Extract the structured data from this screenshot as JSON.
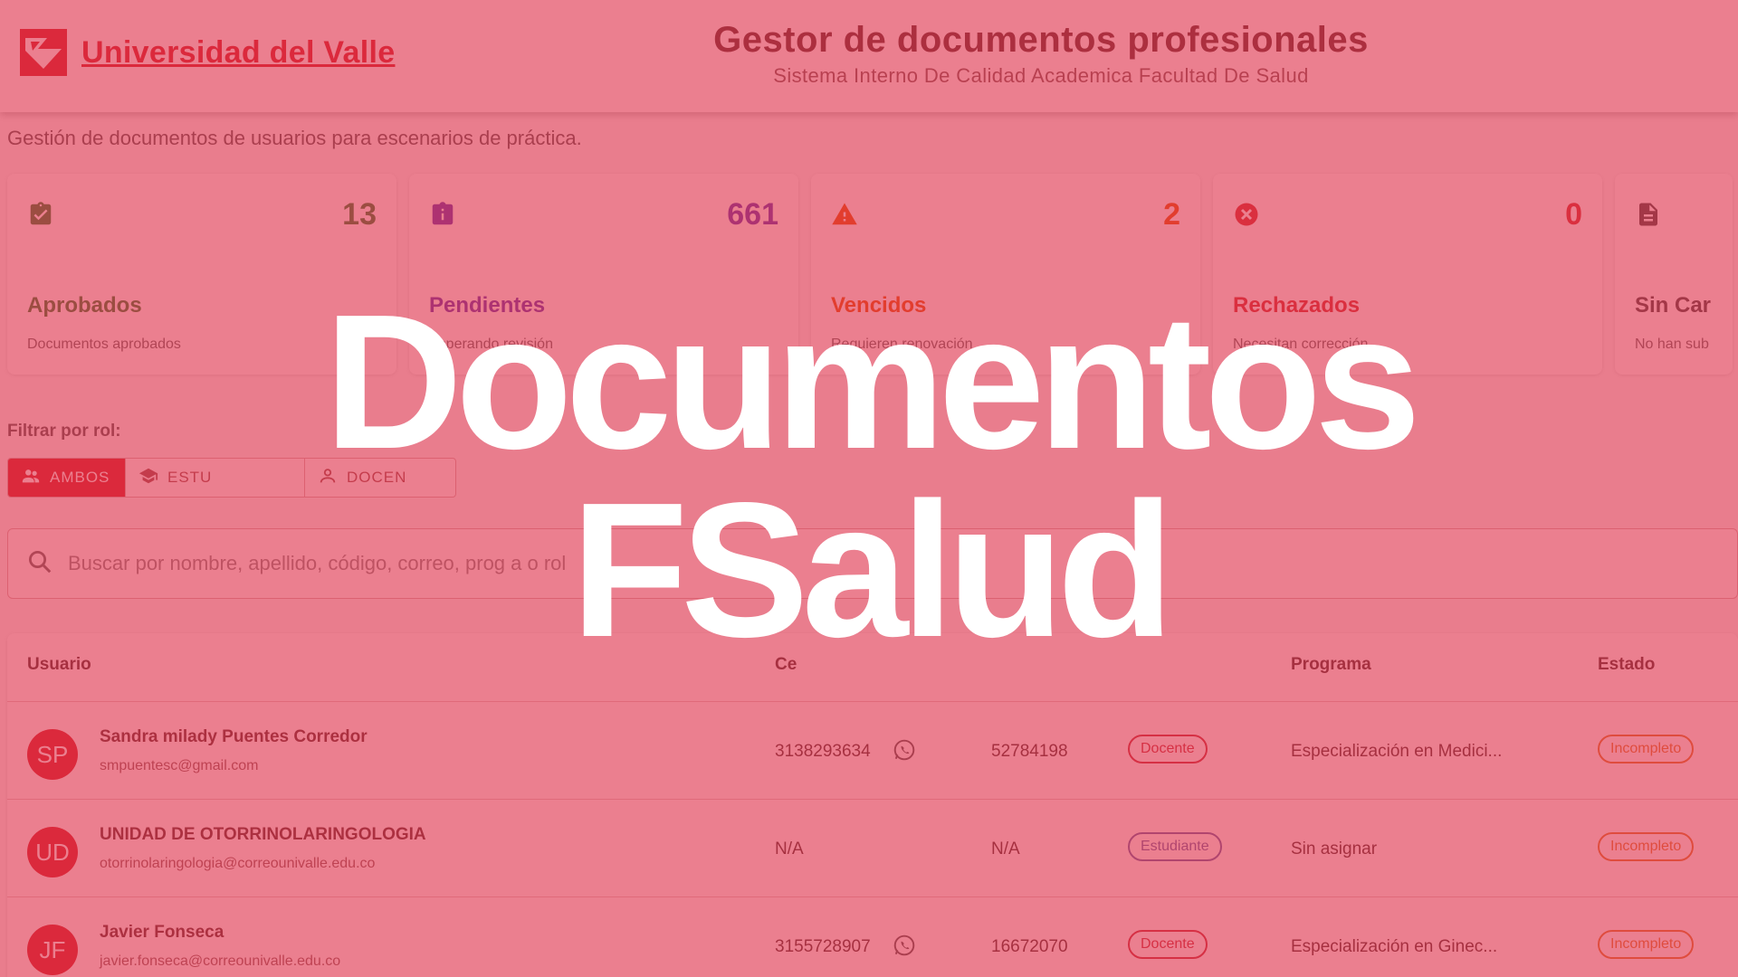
{
  "header": {
    "logo_text": "Universidad del Valle",
    "title": "Gestor de documentos profesionales",
    "subtitle": "Sistema Interno De Calidad Academica Facultad De Salud"
  },
  "intro": "Gestión de documentos de usuarios para escenarios de práctica.",
  "cards": [
    {
      "title": "Aprobados",
      "count": "13",
      "desc": "Documentos aprobados",
      "color": "#2e7d32",
      "icon": "clipboard-check-icon"
    },
    {
      "title": "Pendientes",
      "count": "661",
      "desc": "Esperando revisión",
      "color": "#5e35b1",
      "icon": "pending-icon"
    },
    {
      "title": "Vencidos",
      "count": "2",
      "desc": "Requieren renovación",
      "color": "#e65100",
      "icon": "warning-icon"
    },
    {
      "title": "Rechazados",
      "count": "0",
      "desc": "Necesitan corrección",
      "color": "#d32f2f",
      "icon": "cancel-icon"
    },
    {
      "title": "Sin Car",
      "count": "",
      "desc": "No han sub",
      "color": "#424242",
      "icon": "document-icon"
    }
  ],
  "filter": {
    "label": "Filtrar por rol:",
    "options": [
      "AMBOS",
      "ESTU",
      "DOCEN"
    ],
    "selected": "AMBOS"
  },
  "search": {
    "placeholder": "Buscar por nombre, apellido, código, correo, prog a o rol"
  },
  "table": {
    "columns": [
      "Usuario",
      "Ce",
      "Programa",
      "Estado"
    ],
    "rows": [
      {
        "initials": "SP",
        "name": "Sandra milady Puentes Corredor",
        "email": "smpuentesc@gmail.com",
        "phone": "3138293634",
        "doc": "52784198",
        "role": "Docente",
        "program": "Especialización en Medici...",
        "status": "Incompleto"
      },
      {
        "initials": "UD",
        "name": "UNIDAD DE OTORRINOLARINGOLOGIA",
        "email": "otorrinolaringologia@correounivalle.edu.co",
        "phone": "N/A",
        "doc": "N/A",
        "role": "Estudiante",
        "program": "Sin asignar",
        "status": "Incompleto"
      },
      {
        "initials": "JF",
        "name": "Javier Fonseca",
        "email": "javier.fonseca@correounivalle.edu.co",
        "phone": "3155728907",
        "doc": "16672070",
        "role": "Docente",
        "program": "Especialización en Ginec...",
        "status": "Incompleto"
      }
    ]
  },
  "banner": {
    "line1": "Documentos",
    "line2": "FSalud"
  }
}
